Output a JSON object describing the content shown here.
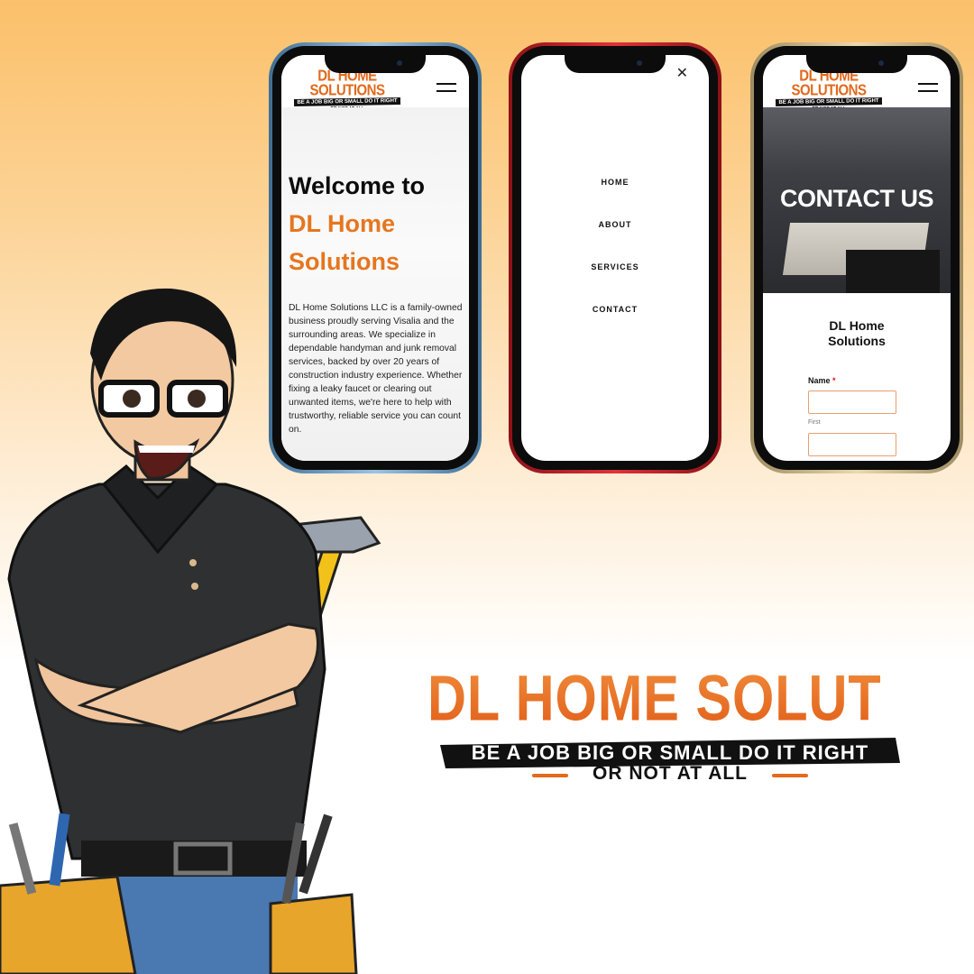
{
  "brand": {
    "name": "DL HOME SOLUTIONS",
    "tagline": "BE A JOB BIG OR SMALL DO IT RIGHT",
    "tagline2": "OR NOT AT ALL",
    "accent": "#e46a1c"
  },
  "phone1": {
    "welcome_line1": "Welcome to",
    "welcome_line2": "DL Home",
    "welcome_line3": "Solutions",
    "about": "DL Home Solutions LLC is a family-owned business proudly serving Visalia and the surrounding areas. We specialize in dependable handyman and junk removal services, backed by over 20 years of construction industry experience. Whether fixing a leaky faucet or clearing out unwanted items, we're here to help with trustworthy, reliable service you can count on."
  },
  "phone2": {
    "close_symbol": "✕",
    "menu": [
      "HOME",
      "ABOUT",
      "SERVICES",
      "CONTACT"
    ]
  },
  "phone3": {
    "hero_title": "CONTACT US",
    "business_name_line1": "DL Home",
    "business_name_line2": "Solutions",
    "name_label": "Name",
    "required_mark": "*",
    "first_sublabel": "First"
  }
}
